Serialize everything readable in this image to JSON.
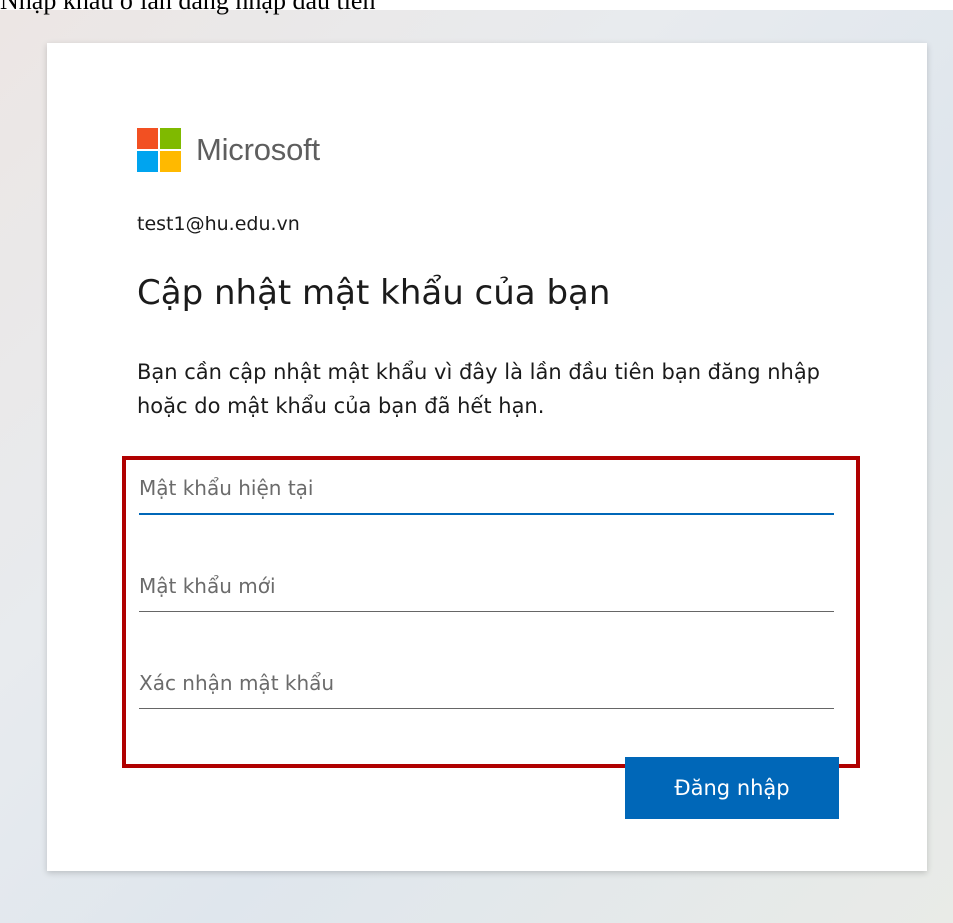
{
  "document": {
    "caption": "Nhập khẩu ở lần đăng nhập đầu tiên"
  },
  "brand": {
    "name": "Microsoft",
    "logo_icon": "microsoft-logo-icon",
    "colors": {
      "red": "#f25022",
      "green": "#7fba00",
      "blue": "#00a4ef",
      "yellow": "#ffb900"
    }
  },
  "login": {
    "account": "test1@hu.edu.vn",
    "title": "Cập nhật mật khẩu của bạn",
    "description": "Bạn cần cập nhật mật khẩu vì đây là lần đầu tiên bạn đăng nhập hoặc do mật khẩu của bạn đã hết hạn.",
    "fields": {
      "current_password_placeholder": "Mật khẩu hiện tại",
      "new_password_placeholder": "Mật khẩu mới",
      "confirm_password_placeholder": "Xác nhận mật khẩu"
    },
    "submit_label": "Đăng nhập",
    "accent_color": "#0067b8",
    "highlight_color": "#b00000"
  }
}
